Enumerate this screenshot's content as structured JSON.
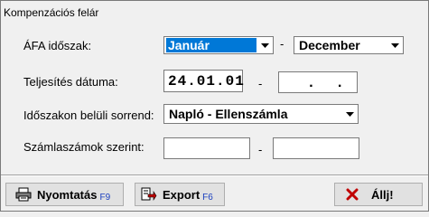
{
  "window": {
    "title": "Kompenzációs felár"
  },
  "form": {
    "afa_label": "ÁFA időszak:",
    "afa_from": "Január",
    "afa_to": "December",
    "afa_dash": "-",
    "teljesites_label": "Teljesítés dátuma:",
    "teljesites_from": "24.01.01",
    "teljesites_to": " .  . ",
    "teljesites_dash": "-",
    "sorrend_label": "Időszakon belüli sorrend:",
    "sorrend_value": "Napló - Ellenszámla",
    "szamla_label": "Számlaszámok szerint:",
    "szamla_from": "",
    "szamla_to": "",
    "szamla_dash": "-"
  },
  "buttons": {
    "print_label": "Nyomtatás",
    "print_key": "F9",
    "export_label": "Export",
    "export_key": "F6",
    "stop_label": "Állj!"
  },
  "colors": {
    "selection": "#0078d7",
    "key_hint": "#1a3fbf",
    "stop_icon": "#c00000"
  },
  "icons": {
    "print": "printer-icon",
    "export": "export-icon",
    "stop": "close-x-icon"
  }
}
